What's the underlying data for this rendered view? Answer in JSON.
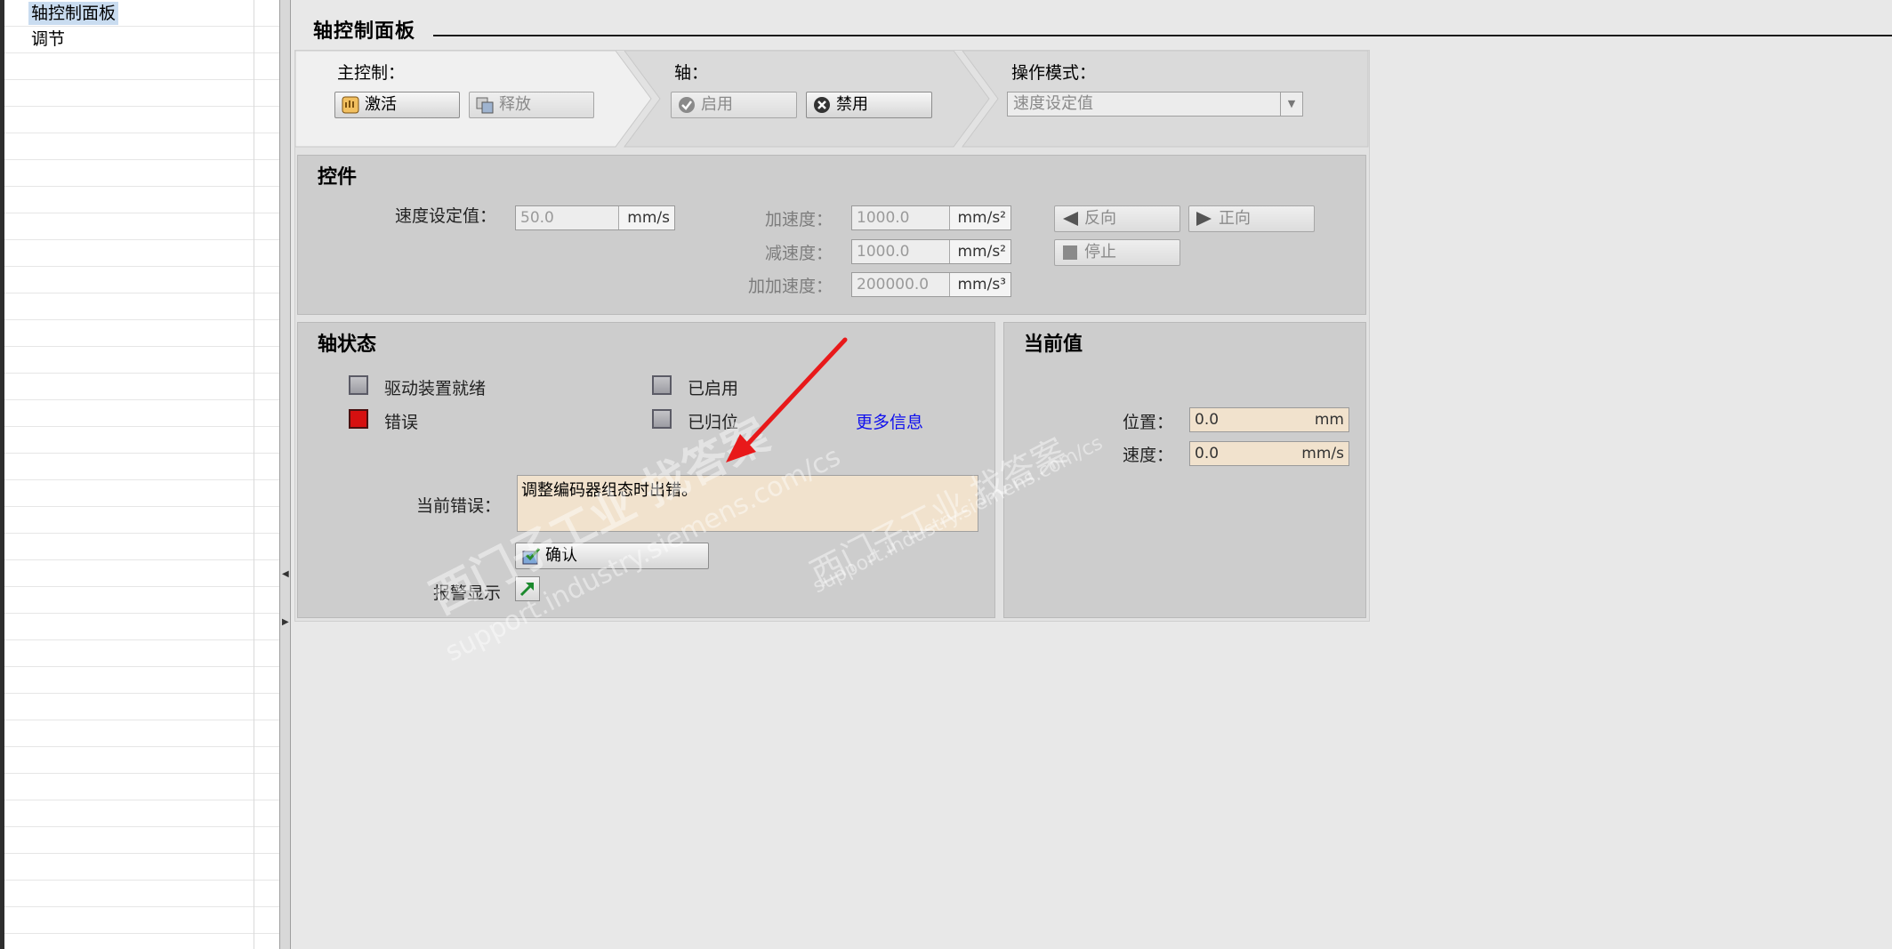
{
  "nav": {
    "items": [
      {
        "label": "轴控制面板",
        "selected": true
      },
      {
        "label": "调节",
        "selected": false
      }
    ]
  },
  "title": "轴控制面板",
  "master": {
    "label": "主控制：",
    "activate": "激活",
    "release": "释放"
  },
  "axis": {
    "label": "轴：",
    "enable": "启用",
    "disable": "禁用"
  },
  "mode": {
    "label": "操作模式：",
    "value": "速度设定值"
  },
  "controls": {
    "title": "控件",
    "velocity_label": "速度设定值：",
    "velocity_value": "50.0",
    "velocity_unit": "mm/s",
    "accel_label": "加速度：",
    "accel_value": "1000.0",
    "accel_unit": "mm/s²",
    "decel_label": "减速度：",
    "decel_value": "1000.0",
    "decel_unit": "mm/s²",
    "jerk_label": "加加速度：",
    "jerk_value": "200000.0",
    "jerk_unit": "mm/s³",
    "backward": "反向",
    "forward": "正向",
    "stop": "停止"
  },
  "status": {
    "title": "轴状态",
    "drive_ready": "驱动装置就绪",
    "enabled": "已启用",
    "error": "错误",
    "homed": "已归位",
    "more_info": "更多信息",
    "current_error_label": "当前错误：",
    "current_error_text": "调整编码器组态时出错。",
    "ack": "确认",
    "alarm_display": "报警显示"
  },
  "current": {
    "title": "当前值",
    "position_label": "位置：",
    "position_value": "0.0",
    "position_unit": "mm",
    "speed_label": "速度：",
    "speed_value": "0.0",
    "speed_unit": "mm/s"
  },
  "watermark": {
    "line1": "西门子工业 找答案",
    "line2": "support.industry.siemens.com/cs"
  },
  "colors": {
    "error_led": "#d61010",
    "link": "#0000ee",
    "annotation_arrow": "#e8191a",
    "value_field": "#f1e2cd"
  }
}
